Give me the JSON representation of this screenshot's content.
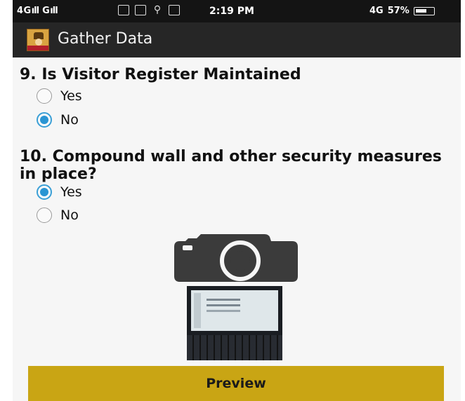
{
  "status_bar": {
    "signal_text": "4G▐ıll G▐ıll",
    "time": "2:19 PM",
    "network": "4G",
    "battery": "57%"
  },
  "app_bar": {
    "title": "Gather Data"
  },
  "questions": [
    {
      "text": "9. Is Visitor Register Maintained",
      "options": [
        {
          "label": "Yes",
          "checked": false
        },
        {
          "label": "No",
          "checked": true
        }
      ]
    },
    {
      "text": "10. Compound wall and other security measures in place?",
      "options": [
        {
          "label": "Yes",
          "checked": true
        },
        {
          "label": "No",
          "checked": false
        }
      ]
    }
  ],
  "icons": {
    "camera": "camera-icon",
    "photo": "photo-thumbnail"
  },
  "preview_button": {
    "label": "Preview"
  },
  "colors": {
    "accent": "#2a95d3",
    "button": "#c9a514",
    "app_bar": "#262626"
  }
}
